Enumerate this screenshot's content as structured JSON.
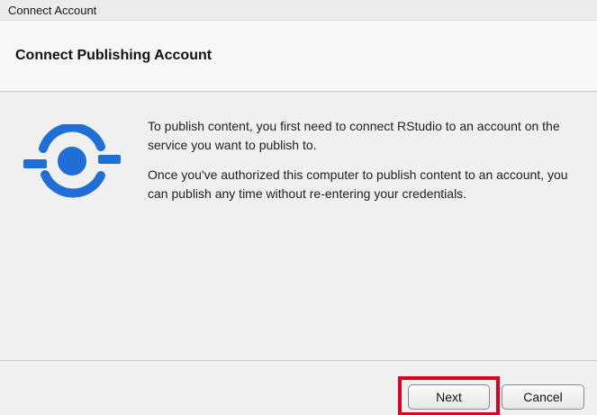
{
  "window": {
    "title": "Connect Account"
  },
  "header": {
    "title": "Connect Publishing Account"
  },
  "content": {
    "icon": "publish-connect-icon",
    "paragraphs": [
      "To publish content, you first need to connect RStudio to an account on the service you want to publish to.",
      "Once you've authorized this computer to publish content to an account, you can publish any time without re-entering your credentials."
    ]
  },
  "footer": {
    "next_label": "Next",
    "cancel_label": "Cancel"
  },
  "colors": {
    "icon_blue": "#1f6fd6",
    "highlight_red": "#e0001b"
  }
}
